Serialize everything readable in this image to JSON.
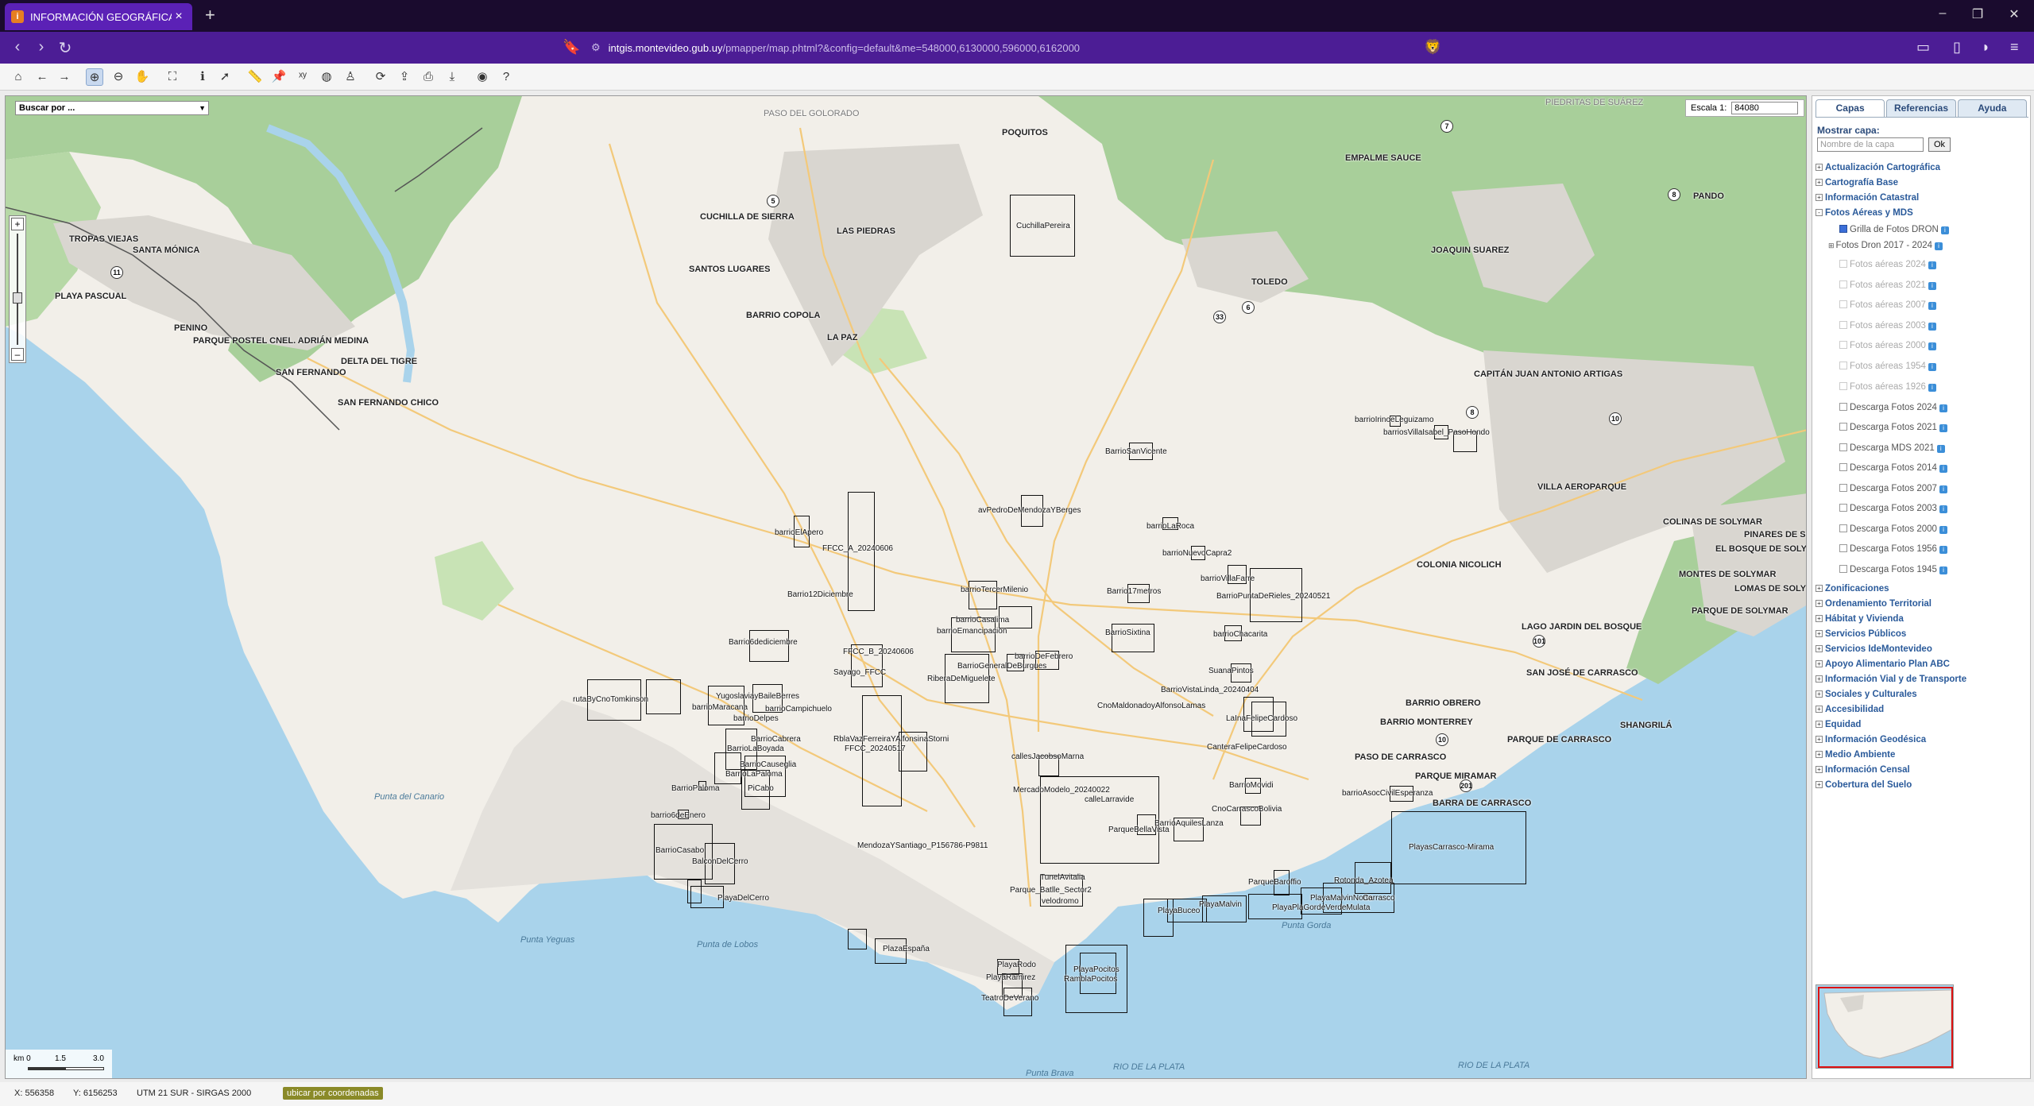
{
  "browser": {
    "tab_title": "INFORMACIÓN GEOGRÁFICA - I",
    "url_host": "intgis.montevideo.gub.uy",
    "url_path": "/pmapper/map.phtml?&config=default&me=548000,6130000,596000,6162000"
  },
  "toolbar": {
    "tools": [
      "home-icon",
      "back-icon",
      "forward-icon",
      "zoom-in-icon",
      "zoom-out-icon",
      "pan-icon",
      "zoom-select-icon",
      "info-icon",
      "select-icon",
      "measure-icon",
      "pin-icon",
      "xy-icon",
      "globe-icon",
      "person-icon",
      "refresh-icon",
      "print-icon",
      "download-icon",
      "reload-icon",
      "coords-icon",
      "help-icon"
    ]
  },
  "map": {
    "search_placeholder": "Buscar por ...",
    "scale_label": "Escala 1:",
    "scale_value": "84080",
    "place_labels": [
      {
        "text": "PIEDRITAS DE SUÁREZ"
      },
      {
        "text": "PASO DEL GOLORADO"
      },
      {
        "text": "POQUITOS"
      },
      {
        "text": "EMPALME SAUCE"
      },
      {
        "text": "PANDO"
      },
      {
        "text": "CUCHILLA DE SIERRA"
      },
      {
        "text": "LAS PIEDRAS"
      },
      {
        "text": "JOAQUIN SUAREZ"
      },
      {
        "text": "TROPAS VIEJAS"
      },
      {
        "text": "SANTA MÓNICA"
      },
      {
        "text": "SANTOS LUGARES"
      },
      {
        "text": "TOLEDO"
      },
      {
        "text": "PLAYA PASCUAL"
      },
      {
        "text": "BARRIO COPOLA"
      },
      {
        "text": "PENINO"
      },
      {
        "text": "LA PAZ"
      },
      {
        "text": "PARQUE POSTEL CNEL. ADRIÁN MEDINA"
      },
      {
        "text": "DELTA DEL TIGRE"
      },
      {
        "text": "SAN FERNANDO"
      },
      {
        "text": "SAN FERNANDO CHICO"
      },
      {
        "text": "CAPITÁN JUAN ANTONIO ARTIGAS"
      },
      {
        "text": "VILLA AEROPARQUE"
      },
      {
        "text": "COLINAS DE SOLYMAR"
      },
      {
        "text": "PINARES DE SO"
      },
      {
        "text": "EL BOSQUE DE SOLY"
      },
      {
        "text": "COLONIA NICOLICH"
      },
      {
        "text": "MONTES DE SOLYMAR"
      },
      {
        "text": "LOMAS DE SOLY"
      },
      {
        "text": "PARQUE DE SOLYMAR"
      },
      {
        "text": "LAGO JARDIN DEL BOSQUE"
      },
      {
        "text": "SAN JOSÉ DE CARRASCO"
      },
      {
        "text": "BARRIO OBRERO"
      },
      {
        "text": "BARRIO MONTERREY"
      },
      {
        "text": "SHANGRILÁ"
      },
      {
        "text": "PARQUE DE CARRASCO"
      },
      {
        "text": "PASO DE CARRASCO"
      },
      {
        "text": "PARQUE MIRAMAR"
      },
      {
        "text": "BARRA DE CARRASCO"
      }
    ],
    "water_labels": [
      {
        "text": "Punta del Canario"
      },
      {
        "text": "Punta Yeguas"
      },
      {
        "text": "Punta de Lobos"
      },
      {
        "text": "RIO DE LA PLATA"
      },
      {
        "text": "Punta Brava"
      },
      {
        "text": "RIO DE LA PLATA"
      },
      {
        "text": "Punta Gorda"
      }
    ],
    "tiles": [
      {
        "label": "CuchillaPereira"
      },
      {
        "label": "BarrioSanVicente"
      },
      {
        "label": "barrioIrinoeLeguizamo"
      },
      {
        "label": "barriosVillaIsabel_PasoHondo"
      },
      {
        "label": "avPedroDeMendozaYBerges"
      },
      {
        "label": "barrioLaRoca"
      },
      {
        "label": "barrioElApero"
      },
      {
        "label": "FFCC_A_20240606"
      },
      {
        "label": "barrioNuevoCapra2"
      },
      {
        "label": "barrioVillaFarre"
      },
      {
        "label": "barrioTercerMilenio"
      },
      {
        "label": "Barrio17metros"
      },
      {
        "label": "BarrioPuntaDeRieles_20240521"
      },
      {
        "label": "Barrio12Diciembre"
      },
      {
        "label": "barrioCasalima"
      },
      {
        "label": "barrioEmancipacion"
      },
      {
        "label": "BarrioSixtina"
      },
      {
        "label": "barrioChacarita"
      },
      {
        "label": "Barrio6dediciembre"
      },
      {
        "label": "FFCC_B_20240606"
      },
      {
        "label": "barrioDeFebrero"
      },
      {
        "label": "BarrioGeneralDeBurgues"
      },
      {
        "label": "SuanaPintos"
      },
      {
        "label": "Sayago_FFCC"
      },
      {
        "label": "RiberaDeMiguelete"
      },
      {
        "label": "BarrioVistaLinda_20240404"
      },
      {
        "label": "rutaByCnoTomkinson"
      },
      {
        "label": "YugoslaviayBaileBerres"
      },
      {
        "label": "barrioMaracana"
      },
      {
        "label": "barrioCampichuelo"
      },
      {
        "label": "CnoMaldonadoyAlfonsoLamas"
      },
      {
        "label": "LaInaFelipeCardoso"
      },
      {
        "label": "barrioDelpes"
      },
      {
        "label": "RblaVazFerreiraYAlfonsinaStorni"
      },
      {
        "label": "FFCC_20240517"
      },
      {
        "label": "BarrioCabrera"
      },
      {
        "label": "BarrioLaBoyada"
      },
      {
        "label": "CanteraFelipeCardoso"
      },
      {
        "label": "callesJacobsoMarna"
      },
      {
        "label": "BarrioCauseglia"
      },
      {
        "label": "BarrioLaPaloma"
      },
      {
        "label": "PiCabo"
      },
      {
        "label": "BarrioPaloma"
      },
      {
        "label": "MercadoModelo_20240022"
      },
      {
        "label": "BarrioMovidi"
      },
      {
        "label": "calleLarravide"
      },
      {
        "label": "barrioAsocCivilEsperanza"
      },
      {
        "label": "barrio6deEnero"
      },
      {
        "label": "CnoCarrascoBolivia"
      },
      {
        "label": "ParqueBellaVista"
      },
      {
        "label": "BarrioAquilesLanza"
      },
      {
        "label": "BarrioCasabo"
      },
      {
        "label": "MendozaYSantiago_P156786-P9811"
      },
      {
        "label": "BalconDelCerro"
      },
      {
        "label": "PlayasCarrasco-Mirama"
      },
      {
        "label": "TunelAvitalia"
      },
      {
        "label": "ParqueBaroffio"
      },
      {
        "label": "Rotonda_Azotea"
      },
      {
        "label": "PlayaDelCerro"
      },
      {
        "label": "Parque_Batlle_Sector2"
      },
      {
        "label": "velodromo"
      },
      {
        "label": "PlayaMalvin"
      },
      {
        "label": "PlayaMalvinNorte"
      },
      {
        "label": "Carrasco"
      },
      {
        "label": "PlayaBuceo"
      },
      {
        "label": "PlayaPlaGordeVerdeMulata"
      },
      {
        "label": "PlazaEspaña"
      },
      {
        "label": "PlayaRodo"
      },
      {
        "label": "PlayaPocitos"
      },
      {
        "label": "RamblaPocitos"
      },
      {
        "label": "PlayaRamirez"
      },
      {
        "label": "TeatroDeVerano"
      }
    ],
    "shields": [
      "7",
      "5",
      "8",
      "11",
      "33",
      "6",
      "10",
      "8",
      "10",
      "101",
      "201"
    ],
    "scalebar": {
      "t0": "km 0",
      "t1": "1.5",
      "t2": "3.0"
    }
  },
  "panel": {
    "tabs": [
      "Capas",
      "Referencias",
      "Ayuda"
    ],
    "mostrar_label": "Mostrar capa:",
    "layer_input_placeholder": "Nombre de la capa",
    "ok_label": "Ok",
    "groups_top": [
      {
        "label": "Actualización Cartográfica",
        "sign": "+"
      },
      {
        "label": "Cartografía Base",
        "sign": "+"
      },
      {
        "label": "Información Catastral",
        "sign": "+"
      },
      {
        "label": "Fotos Aéreas y MDS",
        "sign": "-"
      }
    ],
    "layers": [
      {
        "label": "Grilla de Fotos DRON",
        "checked": true,
        "disabled": false
      },
      {
        "label": "Fotos Dron 2017 - 2024",
        "checked": false,
        "disabled": false,
        "sub": true
      },
      {
        "label": "Fotos aéreas 2024",
        "checked": false,
        "disabled": true
      },
      {
        "label": "Fotos aéreas 2021",
        "checked": false,
        "disabled": true
      },
      {
        "label": "Fotos aéreas 2007",
        "checked": false,
        "disabled": true
      },
      {
        "label": "Fotos aéreas 2003",
        "checked": false,
        "disabled": true
      },
      {
        "label": "Fotos aéreas 2000",
        "checked": false,
        "disabled": true
      },
      {
        "label": "Fotos aéreas 1954",
        "checked": false,
        "disabled": true
      },
      {
        "label": "Fotos aéreas 1926",
        "checked": false,
        "disabled": true
      },
      {
        "label": "Descarga Fotos 2024",
        "checked": false,
        "disabled": false
      },
      {
        "label": "Descarga Fotos 2021",
        "checked": false,
        "disabled": false
      },
      {
        "label": "Descarga MDS 2021",
        "checked": false,
        "disabled": false
      },
      {
        "label": "Descarga Fotos 2014",
        "checked": false,
        "disabled": false
      },
      {
        "label": "Descarga Fotos 2007",
        "checked": false,
        "disabled": false
      },
      {
        "label": "Descarga Fotos 2003",
        "checked": false,
        "disabled": false
      },
      {
        "label": "Descarga Fotos 2000",
        "checked": false,
        "disabled": false
      },
      {
        "label": "Descarga Fotos 1956",
        "checked": false,
        "disabled": false
      },
      {
        "label": "Descarga Fotos 1945",
        "checked": false,
        "disabled": false
      }
    ],
    "groups_bottom": [
      "Zonificaciones",
      "Ordenamiento Territorial",
      "Hábitat y Vivienda",
      "Servicios Públicos",
      "Servicios IdeMontevideo",
      "Apoyo Alimentario Plan ABC",
      "Información Vial y de Transporte",
      "Sociales y Culturales",
      "Accesibilidad",
      "Equidad",
      "Información Geodésica",
      "Medio Ambiente",
      "Información Censal",
      "Cobertura del Suelo"
    ]
  },
  "status": {
    "x": "X: 556358",
    "y": "Y: 6156253",
    "crs": "UTM 21 SUR - SIRGAS 2000",
    "ubicar": "ubicar por coordenadas"
  },
  "colors": {
    "chrome_tabbar": "#1a0b2e",
    "chrome_addressbar": "#4c1d95",
    "tab_active": "#5b21b6",
    "water": "#a9d3eb",
    "land": "#f2efe9",
    "green": "#a8cf9a",
    "urban": "#d9d6d0",
    "link": "#2a5a9a"
  }
}
